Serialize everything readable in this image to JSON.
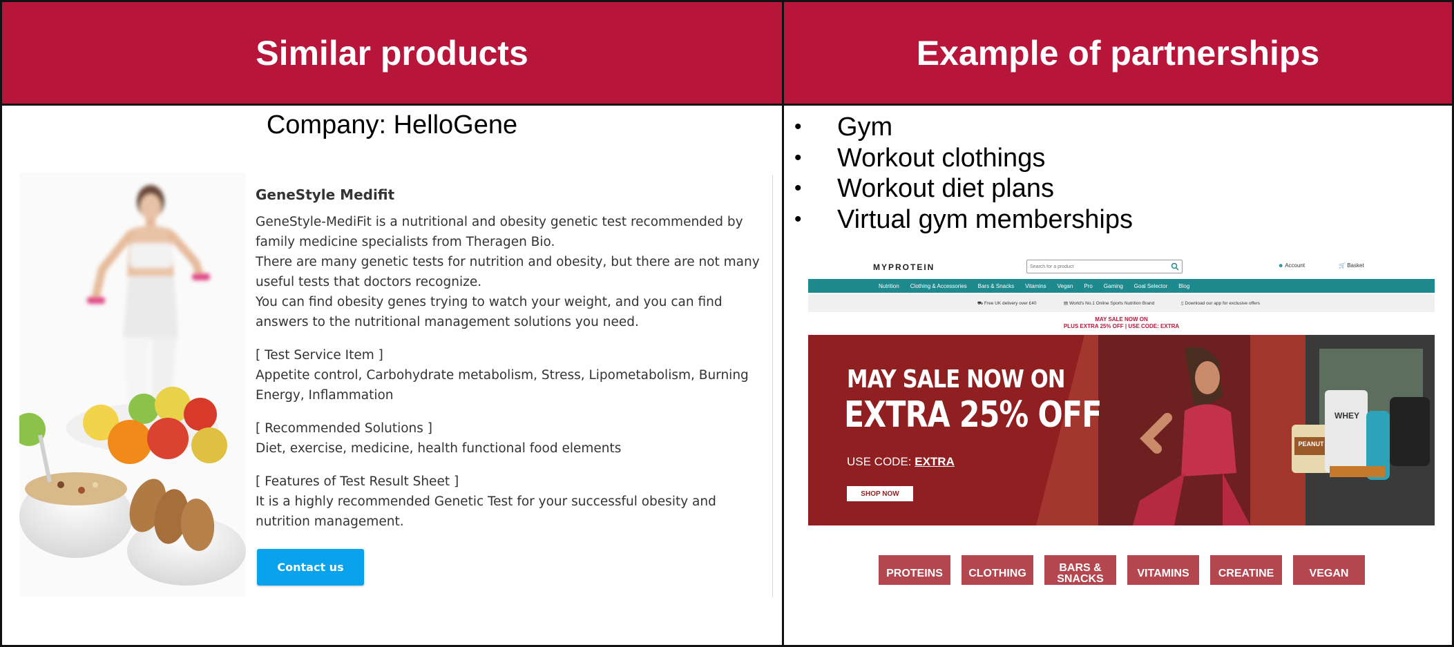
{
  "left": {
    "header": "Similar products",
    "company": "Company: HelloGene",
    "product": {
      "title": "GeneStyle Medifit",
      "description": [
        "GeneStyle-MediFit is a nutritional and obesity genetic test recommended by family medicine specialists from Theragen Bio.",
        "There are many genetic tests for nutrition and obesity, but there are not many useful tests that doctors recognize.",
        "You can find obesity genes trying to watch your weight, and you can find answers to the nutritional management solutions you need."
      ],
      "test_items_heading": "[ Test Service Item ]",
      "test_items": "Appetite control, Carbohydrate metabolism, Stress, Lipometabolism, Burning Energy, Inflammation",
      "solutions_heading": "[ Recommended Solutions ]",
      "solutions": "Diet, exercise, medicine, health functional food elements",
      "features_heading": "[ Features of Test Result Sheet ]",
      "features": "It is a highly recommended Genetic Test for your successful obesity and nutrition management.",
      "contact_label": "Contact us"
    }
  },
  "right": {
    "header": "Example of partnerships",
    "bullets": [
      "Gym",
      "Workout clothings",
      "Workout diet plans",
      "Virtual gym memberships"
    ],
    "myprotein": {
      "logo": "MYPROTEIN",
      "search_placeholder": "Search for a product",
      "account": "Account",
      "basket": "Basket",
      "nav": [
        "Nutrition",
        "Clothing & Accessories",
        "Bars & Snacks",
        "Vitamins",
        "Vegan",
        "Pro",
        "Gaming",
        "Goal Selector",
        "Blog"
      ],
      "strip": [
        "Free UK delivery over £40",
        "World's No.1 Online Sports Nutrition Brand",
        "Download our app for exclusive offers"
      ],
      "sale_line1": "MAY SALE NOW ON",
      "sale_line2": "PLUS EXTRA 25% OFF | USE CODE: EXTRA",
      "banner_line1": "MAY SALE NOW ON",
      "banner_line2": "EXTRA 25% OFF",
      "banner_code_prefix": "USE CODE: ",
      "banner_code": "EXTRA",
      "shop_now": "SHOP NOW",
      "jar_label": "PEANUT",
      "pouch_label": "WHEY",
      "categories": [
        "PROTEINS",
        "CLOTHING",
        "BARS & SNACKS",
        "VITAMINS",
        "CREATINE",
        "VEGAN"
      ]
    }
  },
  "colors": {
    "header_bg": "#b8153b",
    "contact_button": "#08a3ec",
    "myprotein_teal": "#1f8a8e",
    "banner_bg": "#8f1f20",
    "category_button": "#b3464f"
  }
}
